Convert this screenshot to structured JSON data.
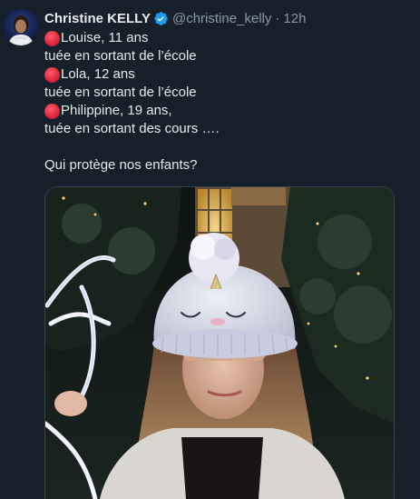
{
  "author": {
    "name": "Christine KELLY",
    "handle": "@christine_kelly",
    "separator": "·",
    "time": "12h",
    "avatar_icon": "profile-avatar",
    "verified_icon": "verified-badge-icon"
  },
  "tweet": {
    "lines": [
      {
        "bullet": "red-circle-emoji",
        "text": "Louise, 11 ans"
      },
      {
        "bullet": null,
        "text": "tuée en sortant de l’école"
      },
      {
        "bullet": "red-circle-emoji",
        "text": "Lola, 12 ans"
      },
      {
        "bullet": null,
        "text": "tuée en sortant de l’école"
      },
      {
        "bullet": "red-circle-emoji",
        "text": "Philippine, 19 ans,"
      },
      {
        "bullet": null,
        "text": "tuée en sortant des cours …."
      },
      {
        "bullet": null,
        "text": ""
      },
      {
        "bullet": null,
        "text": "Qui protège nos enfants?"
      }
    ]
  },
  "media": {
    "type": "photo",
    "icon": "photo-girl-in-knit-hat"
  },
  "colors": {
    "background": "#15202b",
    "text": "#e7e9ea",
    "secondary": "#8b98a5",
    "verified": "#1d9bf0",
    "bullet": "#e0283c"
  }
}
